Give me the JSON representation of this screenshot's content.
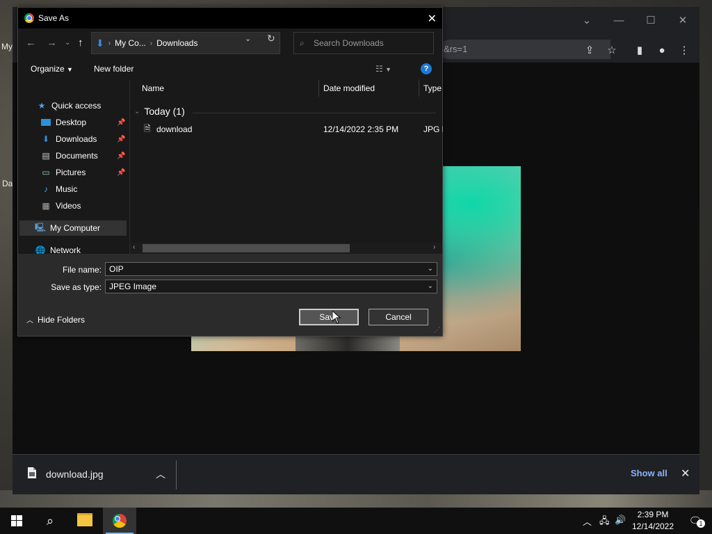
{
  "desktop": {
    "label_my": "My",
    "label_da": "Da"
  },
  "chrome": {
    "omnibox_text": "&rs=1",
    "download_file": "download.jpg",
    "show_all": "Show all"
  },
  "dialog": {
    "title": "Save As",
    "path": [
      "My Co...",
      "Downloads"
    ],
    "search_placeholder": "Search Downloads",
    "organize": "Organize",
    "new_folder": "New folder",
    "nav": [
      {
        "label": "Quick access",
        "icon": "star-icon",
        "pinned": false
      },
      {
        "label": "Desktop",
        "icon": "desktop-folder-icon",
        "pinned": true
      },
      {
        "label": "Downloads",
        "icon": "download-arrow-icon",
        "pinned": true
      },
      {
        "label": "Documents",
        "icon": "documents-icon",
        "pinned": true
      },
      {
        "label": "Pictures",
        "icon": "pictures-icon",
        "pinned": true
      },
      {
        "label": "Music",
        "icon": "music-note-icon",
        "pinned": false
      },
      {
        "label": "Videos",
        "icon": "videos-icon",
        "pinned": false
      },
      {
        "label": "My Computer",
        "icon": "computer-icon",
        "pinned": false
      },
      {
        "label": "Network",
        "icon": "network-icon",
        "pinned": false
      }
    ],
    "columns": [
      "Name",
      "Date modified",
      "Type"
    ],
    "group_label": "Today (1)",
    "files": [
      {
        "name": "download",
        "date": "12/14/2022 2:35 PM",
        "type": "JPG F"
      }
    ],
    "file_name_label": "File name:",
    "file_name_value": "OIP",
    "save_type_label": "Save as type:",
    "save_type_value": "JPEG Image",
    "hide_folders": "Hide Folders",
    "save_label": "Save",
    "cancel_label": "Cancel"
  },
  "taskbar": {
    "time": "2:39 PM",
    "date": "12/14/2022",
    "notification_count": "1"
  }
}
